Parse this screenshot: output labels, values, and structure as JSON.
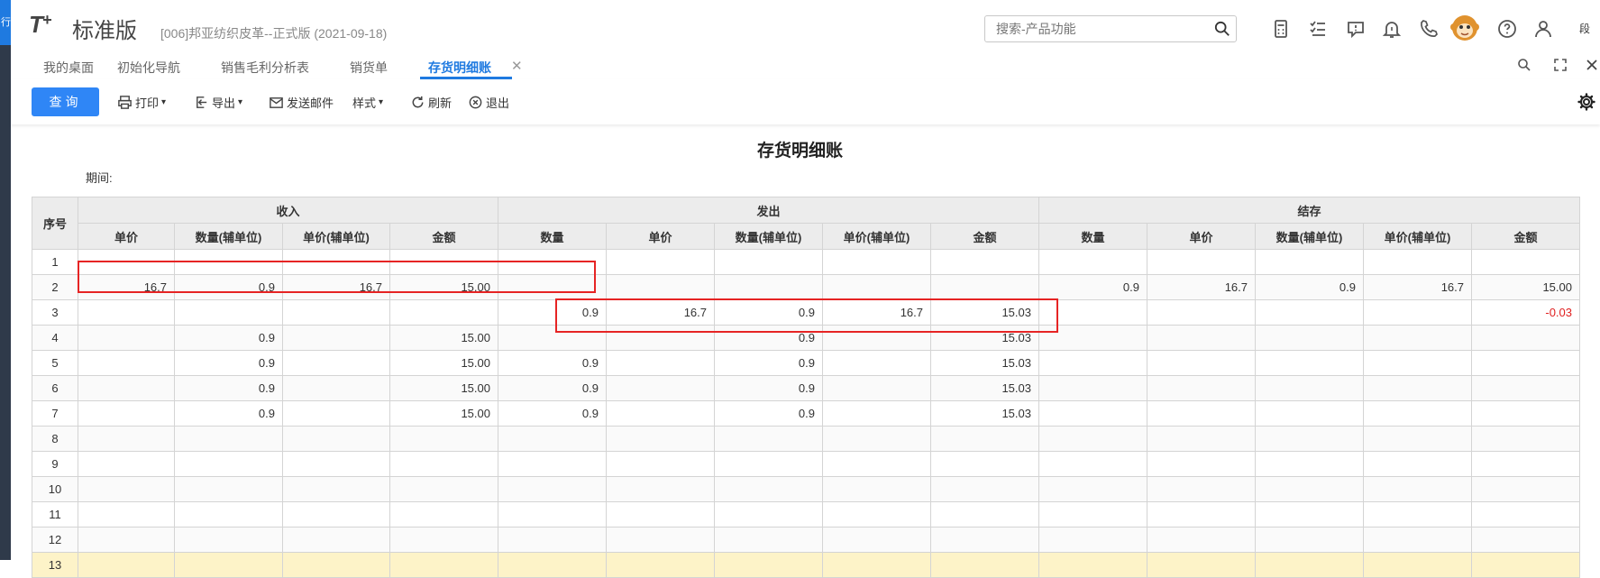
{
  "header": {
    "logo": "T",
    "logo_plus": "+",
    "app_name": "标准版",
    "company": "[006]邦亚纺织皮革--正式版   (2021-09-18)",
    "search_placeholder": "搜索-产品功能",
    "user_label": "段"
  },
  "left_strip_glyph": "行",
  "tabs": [
    {
      "label": "我的桌面"
    },
    {
      "label": "初始化导航"
    },
    {
      "label": "销售毛利分析表"
    },
    {
      "label": "销货单"
    },
    {
      "label": "存货明细账",
      "active": true
    }
  ],
  "toolbar": {
    "query": "查询",
    "print": "打印",
    "export": "导出",
    "send_mail": "发送邮件",
    "style": "样式",
    "refresh": "刷新",
    "exit": "退出"
  },
  "report": {
    "title": "存货明细账",
    "period_label": "期间:"
  },
  "table": {
    "seq_header": "序号",
    "groups": [
      "收入",
      "发出",
      "结存"
    ],
    "income_cols": [
      "单价",
      "数量(辅单位)",
      "单价(辅单位)",
      "金额"
    ],
    "issue_cols": [
      "数量",
      "单价",
      "数量(辅单位)",
      "单价(辅单位)",
      "金额"
    ],
    "balance_cols": [
      "数量",
      "单价",
      "数量(辅单位)",
      "单价(辅单位)",
      "金额"
    ],
    "rows": [
      {
        "seq": "1",
        "cells": [
          "",
          "",
          "",
          "",
          "",
          "",
          "",
          "",
          "",
          "",
          "",
          "",
          "",
          ""
        ]
      },
      {
        "seq": "2",
        "cells": [
          "16.7",
          "0.9",
          "16.7",
          "15.00",
          "",
          "",
          "",
          "",
          "",
          "0.9",
          "16.7",
          "0.9",
          "16.7",
          "15.00"
        ]
      },
      {
        "seq": "3",
        "cells": [
          "",
          "",
          "",
          "",
          "0.9",
          "16.7",
          "0.9",
          "16.7",
          "15.03",
          "",
          "",
          "",
          "",
          "-0.03"
        ]
      },
      {
        "seq": "4",
        "cells": [
          "",
          "0.9",
          "",
          "15.00",
          "",
          "",
          "0.9",
          "",
          "15.03",
          "",
          "",
          "",
          "",
          ""
        ]
      },
      {
        "seq": "5",
        "cells": [
          "",
          "0.9",
          "",
          "15.00",
          "0.9",
          "",
          "0.9",
          "",
          "15.03",
          "",
          "",
          "",
          "",
          ""
        ]
      },
      {
        "seq": "6",
        "cells": [
          "",
          "0.9",
          "",
          "15.00",
          "0.9",
          "",
          "0.9",
          "",
          "15.03",
          "",
          "",
          "",
          "",
          ""
        ]
      },
      {
        "seq": "7",
        "cells": [
          "",
          "0.9",
          "",
          "15.00",
          "0.9",
          "",
          "0.9",
          "",
          "15.03",
          "",
          "",
          "",
          "",
          ""
        ]
      },
      {
        "seq": "8",
        "cells": [
          "",
          "",
          "",
          "",
          "",
          "",
          "",
          "",
          "",
          "",
          "",
          "",
          "",
          ""
        ]
      },
      {
        "seq": "9",
        "cells": [
          "",
          "",
          "",
          "",
          "",
          "",
          "",
          "",
          "",
          "",
          "",
          "",
          "",
          ""
        ]
      },
      {
        "seq": "10",
        "cells": [
          "",
          "",
          "",
          "",
          "",
          "",
          "",
          "",
          "",
          "",
          "",
          "",
          "",
          ""
        ]
      },
      {
        "seq": "11",
        "cells": [
          "",
          "",
          "",
          "",
          "",
          "",
          "",
          "",
          "",
          "",
          "",
          "",
          "",
          ""
        ]
      },
      {
        "seq": "12",
        "cells": [
          "",
          "",
          "",
          "",
          "",
          "",
          "",
          "",
          "",
          "",
          "",
          "",
          "",
          ""
        ]
      },
      {
        "seq": "13",
        "cells": [
          "",
          "",
          "",
          "",
          "",
          "",
          "",
          "",
          "",
          "",
          "",
          "",
          "",
          ""
        ]
      }
    ]
  },
  "colors": {
    "accent": "#1f7ae0",
    "query_button": "#2f86f6",
    "highlight_box": "#e62424",
    "negative": "#e02020",
    "summary_row": "#fdf3c8"
  }
}
